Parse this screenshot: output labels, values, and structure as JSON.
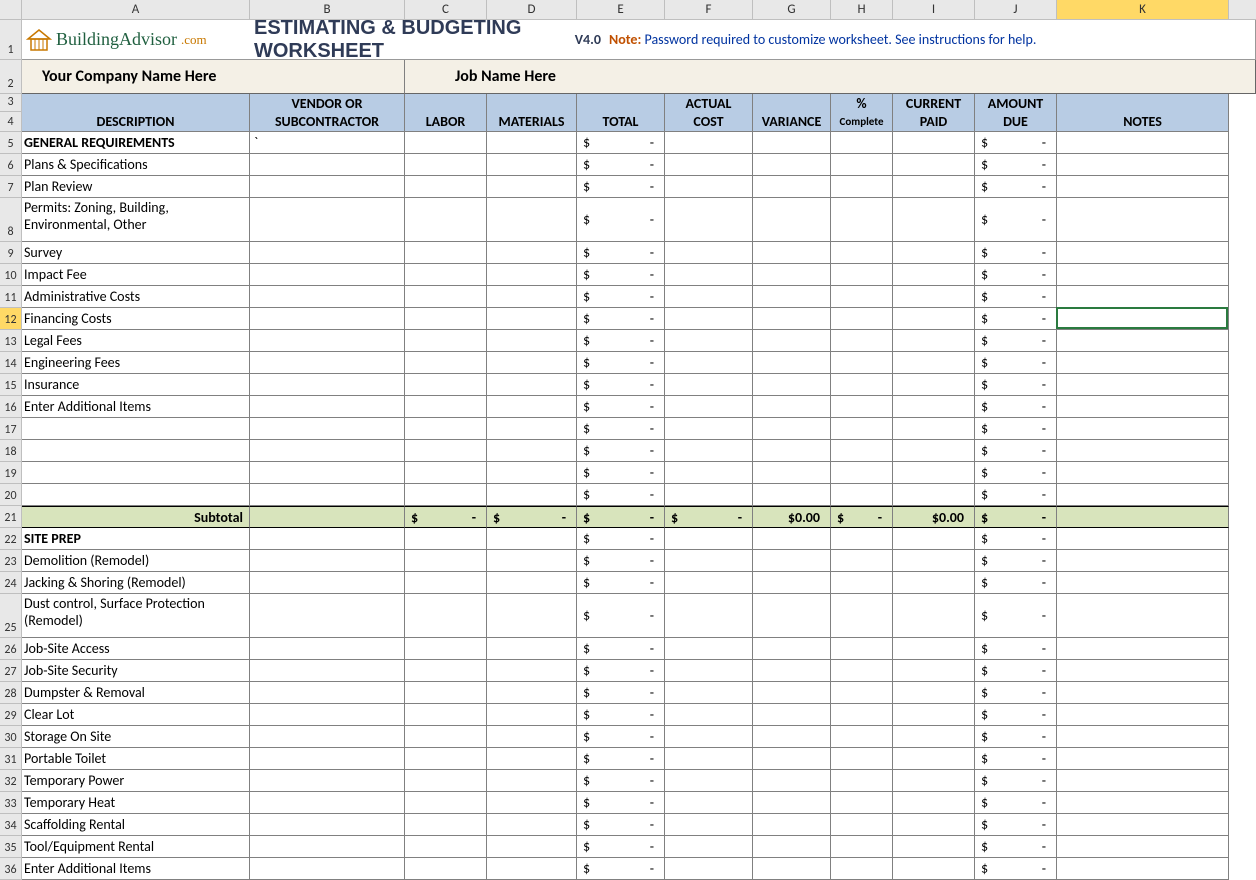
{
  "columns": [
    "A",
    "B",
    "C",
    "D",
    "E",
    "F",
    "G",
    "H",
    "I",
    "J",
    "K"
  ],
  "colWidths": {
    "A": 228,
    "B": 155,
    "C": 82,
    "D": 90,
    "E": 88,
    "F": 88,
    "G": 78,
    "H": 62,
    "I": 82,
    "J": 82,
    "K": 172
  },
  "logo": {
    "name": "BuildingAdvisor",
    "suffix": ".com"
  },
  "title": "ESTIMATING &  BUDGETING WORKSHEET",
  "version": "V4.0",
  "note_label": "Note:",
  "note_text": "Password required to customize worksheet. See instructions for help.",
  "company_placeholder": "Your Company Name Here",
  "job_placeholder": "Job Name Here",
  "headers": {
    "description": "DESCRIPTION",
    "vendor_top": "VENDOR  OR",
    "vendor_bot": "SUBCONTRACTOR",
    "labor": "LABOR",
    "materials": "MATERIALS",
    "total": "TOTAL",
    "actual_top": "ACTUAL",
    "actual_bot": "COST",
    "variance": "VARIANCE",
    "pct_top": "%",
    "pct_bot": "Complete",
    "paid_top": "CURRENT",
    "paid_bot": "PAID",
    "due_top": "AMOUNT",
    "due_bot": "DUE",
    "notes": "NOTES"
  },
  "rows": [
    {
      "n": 5,
      "type": "section",
      "desc": "GENERAL REQUIREMENTS",
      "vendor": "`"
    },
    {
      "n": 6,
      "type": "item",
      "desc": "Plans & Specifications"
    },
    {
      "n": 7,
      "type": "item",
      "desc": "Plan Review"
    },
    {
      "n": 8,
      "type": "item",
      "desc": "Permits: Zoning, Building, Environmental, Other",
      "tall": true
    },
    {
      "n": 9,
      "type": "item",
      "desc": "Survey"
    },
    {
      "n": 10,
      "type": "item",
      "desc": "Impact Fee"
    },
    {
      "n": 11,
      "type": "item",
      "desc": "Administrative Costs"
    },
    {
      "n": 12,
      "type": "item",
      "desc": "Financing Costs",
      "selected": true
    },
    {
      "n": 13,
      "type": "item",
      "desc": "Legal Fees"
    },
    {
      "n": 14,
      "type": "item",
      "desc": "Engineering Fees"
    },
    {
      "n": 15,
      "type": "item",
      "desc": "Insurance"
    },
    {
      "n": 16,
      "type": "item",
      "desc": "Enter Additional Items"
    },
    {
      "n": 17,
      "type": "item",
      "desc": ""
    },
    {
      "n": 18,
      "type": "item",
      "desc": ""
    },
    {
      "n": 19,
      "type": "item",
      "desc": ""
    },
    {
      "n": 20,
      "type": "item",
      "desc": ""
    },
    {
      "n": 21,
      "type": "subtotal",
      "desc": "Subtotal",
      "labor": "$            -",
      "materials": "$            -",
      "total": "$            -",
      "actual": "$            -",
      "variance": "$0.00",
      "pct": "$        -",
      "paid": "$0.00",
      "due": "$            -"
    },
    {
      "n": 22,
      "type": "section",
      "desc": "SITE PREP"
    },
    {
      "n": 23,
      "type": "item",
      "desc": "Demolition (Remodel)"
    },
    {
      "n": 24,
      "type": "item",
      "desc": "Jacking & Shoring (Remodel)"
    },
    {
      "n": 25,
      "type": "item",
      "desc": "Dust control, Surface Protection (Remodel)",
      "tall": true
    },
    {
      "n": 26,
      "type": "item",
      "desc": "Job-Site Access"
    },
    {
      "n": 27,
      "type": "item",
      "desc": "Job-Site Security"
    },
    {
      "n": 28,
      "type": "item",
      "desc": "Dumpster & Removal"
    },
    {
      "n": 29,
      "type": "item",
      "desc": "Clear Lot"
    },
    {
      "n": 30,
      "type": "item",
      "desc": "Storage On Site"
    },
    {
      "n": 31,
      "type": "item",
      "desc": "Portable Toilet"
    },
    {
      "n": 32,
      "type": "item",
      "desc": "Temporary Power"
    },
    {
      "n": 33,
      "type": "item",
      "desc": "Temporary Heat"
    },
    {
      "n": 34,
      "type": "item",
      "desc": "Scaffolding Rental"
    },
    {
      "n": 35,
      "type": "item",
      "desc": "Tool/Equipment Rental"
    },
    {
      "n": 36,
      "type": "item",
      "desc": "Enter Additional Items"
    }
  ],
  "dollar_placeholder": {
    "sign": "$",
    "dash": "-"
  },
  "active_cell": {
    "row": 12,
    "col": "K"
  }
}
